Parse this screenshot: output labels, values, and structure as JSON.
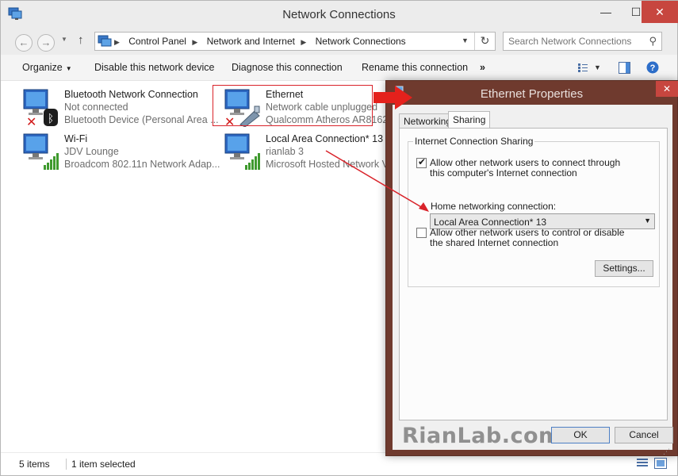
{
  "window": {
    "title": "Network Connections",
    "controls": {
      "minimize": "—",
      "maximize": "☐",
      "close": "✕"
    }
  },
  "address": {
    "breadcrumbs": [
      "Control Panel",
      "Network and Internet",
      "Network Connections"
    ],
    "search_placeholder": "Search Network Connections"
  },
  "toolbar": {
    "organize": "Organize",
    "disable": "Disable this network device",
    "diagnose": "Diagnose this connection",
    "rename": "Rename this connection",
    "more": "»"
  },
  "connections": [
    {
      "name": "Bluetooth Network Connection",
      "status": "Not connected",
      "device": "Bluetooth Device (Personal Area ..."
    },
    {
      "name": "Ethernet",
      "status": "Network cable unplugged",
      "device": "Qualcomm Atheros AR8162/"
    },
    {
      "name": "Wi-Fi",
      "status": "JDV Lounge",
      "device": "Broadcom 802.11n Network Adap..."
    },
    {
      "name": "Local Area Connection* 13",
      "status": "rianlab  3",
      "device": "Microsoft Hosted Network V"
    }
  ],
  "status_bar": {
    "count": "5 items",
    "selected": "1 item selected"
  },
  "dialog": {
    "title": "Ethernet Properties",
    "tabs": [
      "Networking",
      "Sharing"
    ],
    "group_title": "Internet Connection Sharing",
    "allow_connect_label": "Allow other network users to connect through this computer's Internet connection",
    "home_label": "Home networking connection:",
    "home_value": "Local Area Connection* 13",
    "allow_control_label": "Allow other network users to control or disable the shared Internet connection",
    "settings_button": "Settings...",
    "ok_button": "OK",
    "cancel_button": "Cancel",
    "watermark": "RianLab.com"
  },
  "colors": {
    "annotation_red": "#d9232a",
    "dialog_frame": "#6f3a2e",
    "close_red": "#c7463f"
  }
}
